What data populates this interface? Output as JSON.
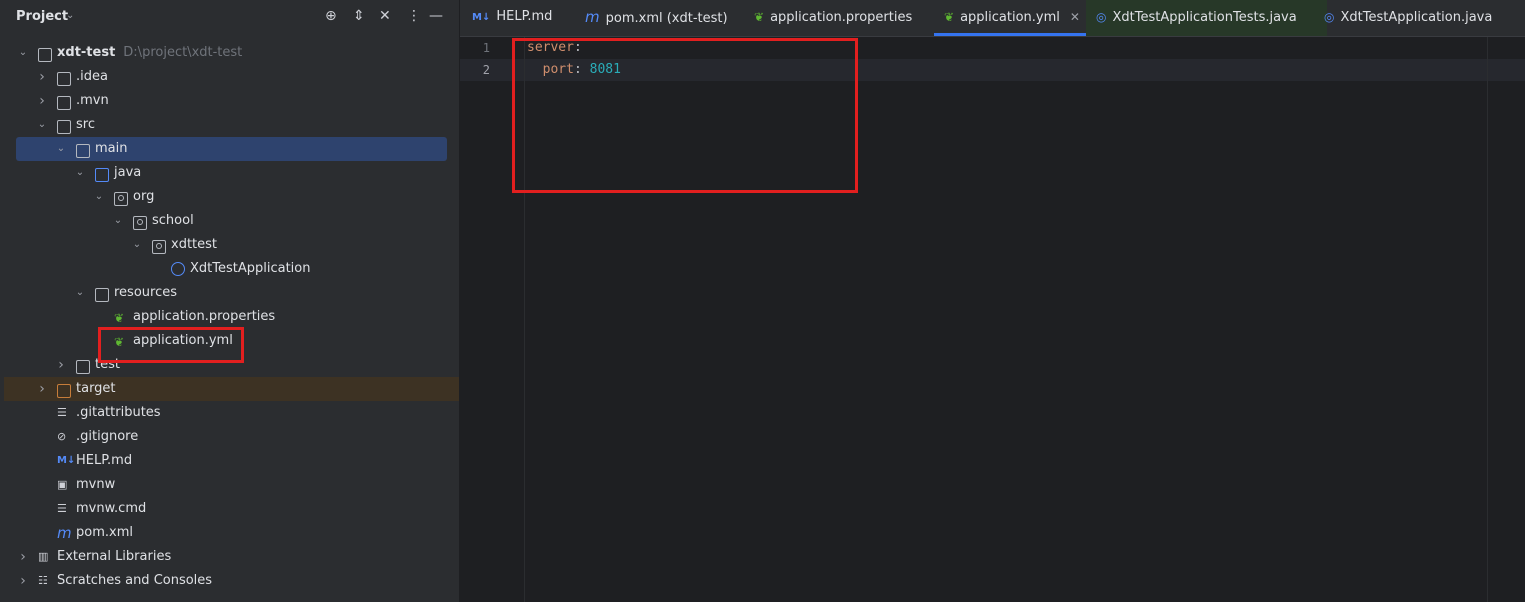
{
  "project_panel": {
    "title": "Project",
    "root": {
      "name": "xdt-test",
      "path": "D:\\project\\xdt-test"
    },
    "tree": [
      {
        "label": "xdt-test",
        "hint": "D:\\project\\xdt-test",
        "depth": 0,
        "expanded": true,
        "icon": "module-folder-icon"
      },
      {
        "label": ".idea",
        "depth": 1,
        "expanded": false,
        "icon": "folder-icon"
      },
      {
        "label": ".mvn",
        "depth": 1,
        "expanded": false,
        "icon": "folder-icon"
      },
      {
        "label": "src",
        "depth": 1,
        "expanded": true,
        "icon": "folder-icon"
      },
      {
        "label": "main",
        "depth": 2,
        "expanded": true,
        "icon": "folder-icon",
        "selected": true
      },
      {
        "label": "java",
        "depth": 3,
        "expanded": true,
        "icon": "source-folder-icon"
      },
      {
        "label": "org",
        "depth": 4,
        "expanded": true,
        "icon": "package-icon"
      },
      {
        "label": "school",
        "depth": 5,
        "expanded": true,
        "icon": "package-icon"
      },
      {
        "label": "xdttest",
        "depth": 6,
        "expanded": true,
        "icon": "package-icon"
      },
      {
        "label": "XdtTestApplication",
        "depth": 7,
        "icon": "spring-class-icon"
      },
      {
        "label": "resources",
        "depth": 3,
        "expanded": true,
        "icon": "resources-folder-icon"
      },
      {
        "label": "application.properties",
        "depth": 4,
        "icon": "spring-config-icon"
      },
      {
        "label": "application.yml",
        "depth": 4,
        "icon": "spring-config-icon"
      },
      {
        "label": "test",
        "depth": 2,
        "expanded": false,
        "icon": "folder-icon"
      },
      {
        "label": "target",
        "depth": 1,
        "expanded": false,
        "icon": "excluded-folder-icon"
      },
      {
        "label": ".gitattributes",
        "depth": 1,
        "icon": "text-file-icon"
      },
      {
        "label": ".gitignore",
        "depth": 1,
        "icon": "ignore-file-icon"
      },
      {
        "label": "HELP.md",
        "depth": 1,
        "icon": "markdown-icon"
      },
      {
        "label": "mvnw",
        "depth": 1,
        "icon": "shell-script-icon"
      },
      {
        "label": "mvnw.cmd",
        "depth": 1,
        "icon": "text-file-icon"
      },
      {
        "label": "pom.xml",
        "depth": 1,
        "icon": "maven-icon"
      },
      {
        "label": "External Libraries",
        "depth": 0,
        "expanded": false,
        "icon": "libraries-icon"
      },
      {
        "label": "Scratches and Consoles",
        "depth": 0,
        "expanded": false,
        "icon": "scratches-icon"
      }
    ]
  },
  "tabs": [
    {
      "label": "HELP.md",
      "icon": "markdown-icon"
    },
    {
      "label": "pom.xml (xdt-test)",
      "icon": "maven-icon"
    },
    {
      "label": "application.properties",
      "icon": "spring-config-icon"
    },
    {
      "label": "application.yml",
      "icon": "spring-config-icon",
      "active": true
    },
    {
      "label": "XdtTestApplicationTests.java",
      "icon": "spring-class-icon"
    },
    {
      "label": "XdtTestApplication.java",
      "icon": "spring-class-icon"
    }
  ],
  "editor": {
    "lines": [
      {
        "num": "1",
        "key": "server",
        "sep": ":",
        "value": ""
      },
      {
        "num": "2",
        "key": "port",
        "sep": ": ",
        "value": "8081",
        "indent": "  "
      }
    ]
  },
  "colors": {
    "accent": "#3574f0",
    "selection": "#2e436e",
    "annotation": "#e21f1f"
  }
}
